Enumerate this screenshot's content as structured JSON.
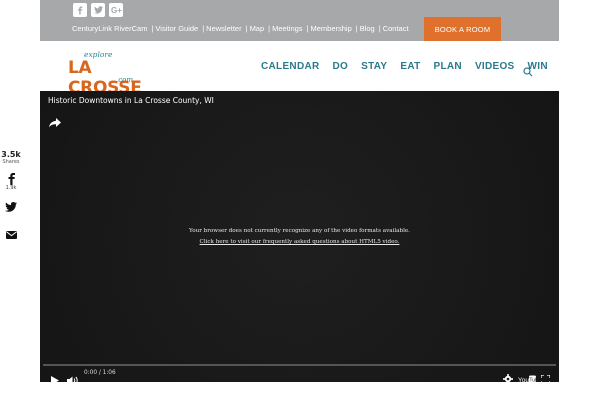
{
  "share": {
    "total": "3.5k",
    "total_label": "Shares",
    "facebook_count": "1.9k",
    "icons": [
      "facebook-icon",
      "twitter-icon",
      "email-icon"
    ]
  },
  "topbar": {
    "social_icons": [
      "facebook-icon",
      "twitter-icon",
      "google-plus-icon"
    ],
    "links": [
      {
        "label": "CenturyLink RiverCam"
      },
      {
        "label": "Visitor Guide"
      },
      {
        "label": "Newsletter"
      },
      {
        "label": "Map"
      },
      {
        "label": "Meetings"
      },
      {
        "label": "Membership"
      },
      {
        "label": "Blog"
      },
      {
        "label": "Contact"
      }
    ],
    "separator": "|",
    "book_label": "BOOK A ROOM",
    "colors": {
      "bar": "#a7a8aa",
      "book": "#e0712c"
    }
  },
  "logo": {
    "explore": "explore",
    "main": "LA CROSSE",
    "com": ".com",
    "colors": {
      "main": "#d9661f",
      "accent": "#2a8596"
    }
  },
  "nav": {
    "items": [
      "CALENDAR",
      "DO",
      "STAY",
      "EAT",
      "PLAN",
      "VIDEOS",
      "WIN"
    ],
    "color": "#2a7a8c",
    "search_icon": "search-icon"
  },
  "video": {
    "title": "Historic Downtowns in La Crosse County, WI",
    "message_line1": "Your browser does not currently recognize any of the video formats available.",
    "message_line2": "Click here to visit our frequently asked questions about HTML5 video.",
    "time": "0:00 / 1:06",
    "controls_icons": [
      "play-icon",
      "volume-icon",
      "gear-icon",
      "youtube-icon",
      "fullscreen-icon"
    ]
  }
}
